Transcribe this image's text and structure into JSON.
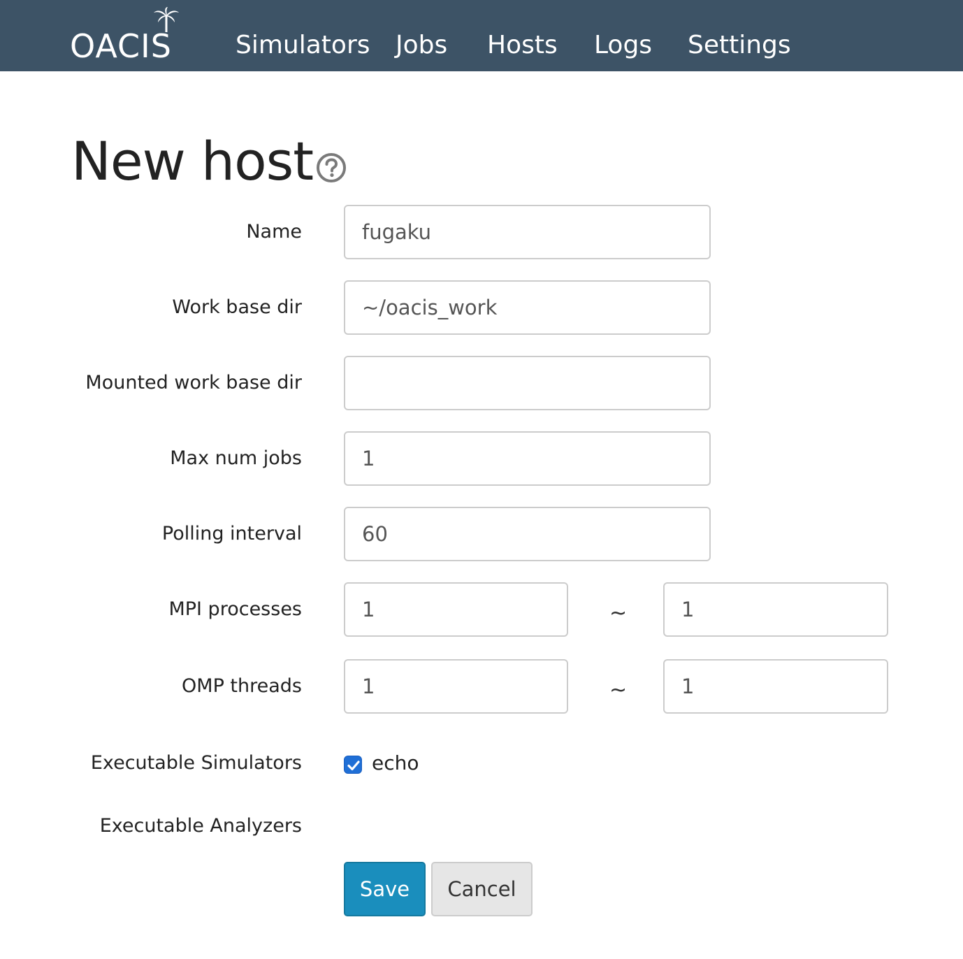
{
  "brand": {
    "name": "OACIS"
  },
  "nav": {
    "items": [
      {
        "label": "Simulators"
      },
      {
        "label": "Jobs"
      },
      {
        "label": "Hosts"
      },
      {
        "label": "Logs"
      },
      {
        "label": "Settings"
      }
    ]
  },
  "page": {
    "title": "New host"
  },
  "form": {
    "name": {
      "label": "Name",
      "value": "fugaku"
    },
    "work_base_dir": {
      "label": "Work base dir",
      "value": "~/oacis_work"
    },
    "mounted_work_base_dir": {
      "label": "Mounted work base dir",
      "value": ""
    },
    "max_num_jobs": {
      "label": "Max num jobs",
      "value": "1"
    },
    "polling_interval": {
      "label": "Polling interval",
      "value": "60"
    },
    "mpi_processes": {
      "label": "MPI processes",
      "min": "1",
      "separator": "~",
      "max": "1"
    },
    "omp_threads": {
      "label": "OMP threads",
      "min": "1",
      "separator": "~",
      "max": "1"
    },
    "executable_simulators": {
      "label": "Executable Simulators",
      "items": [
        {
          "label": "echo",
          "checked": true
        }
      ]
    },
    "executable_analyzers": {
      "label": "Executable Analyzers"
    },
    "save_label": "Save",
    "cancel_label": "Cancel"
  },
  "colors": {
    "navbar_bg": "#3d5366",
    "primary_button": "#1a8ebd",
    "default_button": "#e6e6e6",
    "checkbox_checked": "#1f6fd6"
  }
}
